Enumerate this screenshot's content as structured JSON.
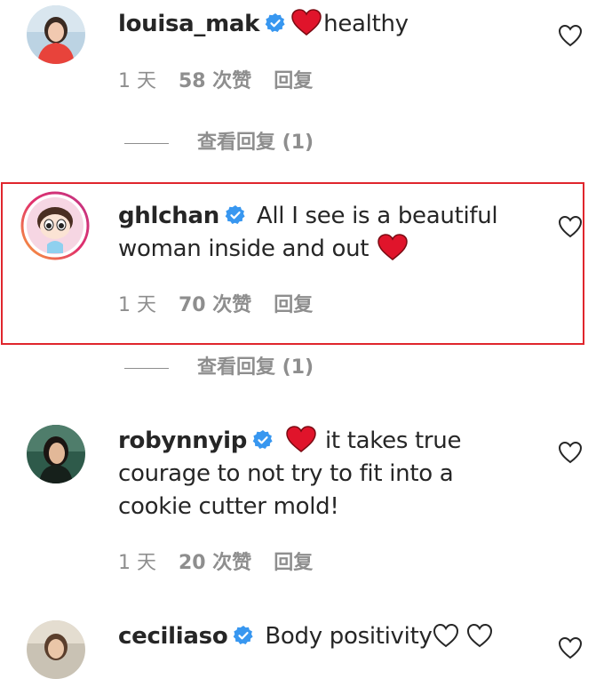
{
  "comments": [
    {
      "username": "louisa_mak",
      "text_before": "",
      "text_after": "healthy",
      "time": "1 天",
      "likes": "58 次赞",
      "reply": "回复",
      "view_replies": "查看回复 (1)",
      "emoji": "red-heart"
    },
    {
      "username": "ghlchan",
      "text_before": "All I see is a beautiful woman inside and out",
      "text_after": "",
      "time": "1 天",
      "likes": "70 次赞",
      "reply": "回复",
      "view_replies": "查看回复 (1)",
      "emoji": "red-heart"
    },
    {
      "username": "robynnyip",
      "text_before": "",
      "text_after": " it takes true courage to not try to fit into a cookie cutter mold!",
      "time": "1 天",
      "likes": "20 次赞",
      "reply": "回复",
      "emoji": "red-heart"
    },
    {
      "username": "ceciliaso",
      "text_before": "Body positivity",
      "text_after": "",
      "emoji": "white-heart"
    }
  ],
  "colors": {
    "highlight_border": "#e0262d",
    "verified_blue": "#3897f0",
    "heart_red": "#e0142b",
    "meta_gray": "#8e8e8e"
  }
}
